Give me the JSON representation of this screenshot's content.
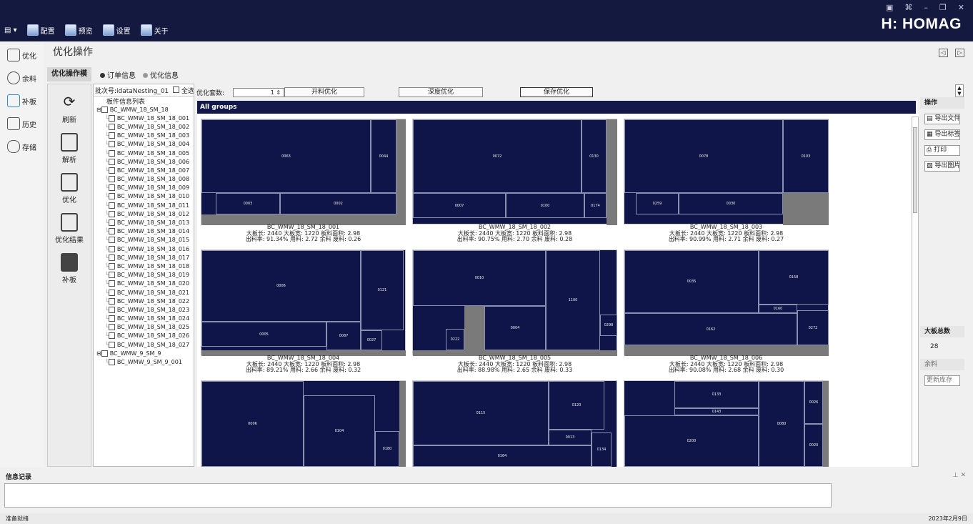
{
  "menu": [
    {
      "label": "配置",
      "icon": "config-icon"
    },
    {
      "label": "预览",
      "icon": "preview-icon"
    },
    {
      "label": "设置",
      "icon": "settings-icon"
    },
    {
      "label": "关于",
      "icon": "about-icon"
    }
  ],
  "brand": "HOMAG",
  "nav": [
    {
      "label": "优化",
      "icon": "optimize-icon"
    },
    {
      "label": "余料",
      "icon": "remnant-icon"
    },
    {
      "label": "补板",
      "icon": "supplement-icon"
    },
    {
      "label": "历史",
      "icon": "history-icon"
    },
    {
      "label": "存储",
      "icon": "storage-icon"
    }
  ],
  "page_title": "优化操作",
  "tool_tab": "优化操作模",
  "sub_tabs": [
    "订单信息",
    "优化信息"
  ],
  "tools": [
    {
      "label": "刷新",
      "icon": "refresh-icon"
    },
    {
      "label": "解析",
      "icon": "parse-icon"
    },
    {
      "label": "优化",
      "icon": "optimize-icon"
    },
    {
      "label": "优化结果",
      "icon": "result-icon"
    },
    {
      "label": "补板",
      "icon": "supplement-icon"
    }
  ],
  "batch": {
    "label": "批次号:idataNesting_01",
    "select_all": "全选"
  },
  "tree": {
    "header": "板件信息列表",
    "root1": "BC_WMW_18_SM_18",
    "items": [
      "BC_WMW_18_SM_18_001",
      "BC_WMW_18_SM_18_002",
      "BC_WMW_18_SM_18_003",
      "BC_WMW_18_SM_18_004",
      "BC_WMW_18_SM_18_005",
      "BC_WMW_18_SM_18_006",
      "BC_WMW_18_SM_18_007",
      "BC_WMW_18_SM_18_008",
      "BC_WMW_18_SM_18_009",
      "BC_WMW_18_SM_18_010",
      "BC_WMW_18_SM_18_011",
      "BC_WMW_18_SM_18_012",
      "BC_WMW_18_SM_18_013",
      "BC_WMW_18_SM_18_014",
      "BC_WMW_18_SM_18_015",
      "BC_WMW_18_SM_18_016",
      "BC_WMW_18_SM_18_017",
      "BC_WMW_18_SM_18_018",
      "BC_WMW_18_SM_18_019",
      "BC_WMW_18_SM_18_020",
      "BC_WMW_18_SM_18_021",
      "BC_WMW_18_SM_18_022",
      "BC_WMW_18_SM_18_023",
      "BC_WMW_18_SM_18_024",
      "BC_WMW_18_SM_18_025",
      "BC_WMW_18_SM_18_026",
      "BC_WMW_18_SM_18_027"
    ],
    "root2": "BC_WMW_9_SM_9",
    "items2": [
      "BC_WMW_9_SM_9_001"
    ]
  },
  "opt": {
    "sets_label": "优化套数:",
    "sets_value": "1",
    "btn_open": "开料优化",
    "btn_deep": "深度优化",
    "btn_save": "保存优化"
  },
  "group_title": "All groups",
  "sheets": [
    {
      "name": "BC_WMW_18_SM_18_001",
      "l1": "大板长: 2440 大板宽: 1220 板料面积: 2.98",
      "l2": "出料率: 91.34% 用料: 2.72 余料 废料: 0.26"
    },
    {
      "name": "BC_WMW_18_SM_18_002",
      "l1": "大板长: 2440 大板宽: 1220 板料面积: 2.98",
      "l2": "出料率: 90.75% 用料: 2.70 余料 废料: 0.28"
    },
    {
      "name": "BC_WMW_18_SM_18_003",
      "l1": "大板长: 2440 大板宽: 1220 板料面积: 2.98",
      "l2": "出料率: 90.99% 用料: 2.71 余料 废料: 0.27"
    },
    {
      "name": "BC_WMW_18_SM_18_004",
      "l1": "大板长: 2440 大板宽: 1220 板料面积: 2.98",
      "l2": "出料率: 89.21% 用料: 2.66 余料 废料: 0.32"
    },
    {
      "name": "BC_WMW_18_SM_18_005",
      "l1": "大板长: 2440 大板宽: 1220 板料面积: 2.98",
      "l2": "出料率: 88.98% 用料: 2.65 余料 废料: 0.33"
    },
    {
      "name": "BC_WMW_18_SM_18_006",
      "l1": "大板长: 2440 大板宽: 1220 板料面积: 2.98",
      "l2": "出料率: 90.08% 用料: 2.68 余料 废料: 0.30"
    }
  ],
  "parts": [
    [
      "0063",
      "0044",
      "0003",
      "0002"
    ],
    [
      "0072",
      "0130",
      "0007",
      "0100",
      "0174"
    ],
    [
      "0078",
      "0103",
      "0259",
      "0030"
    ],
    [
      "0006",
      "0121",
      "0005",
      "0027",
      "0087"
    ],
    [
      "0010",
      "1100",
      "0004",
      "0298",
      "0222"
    ],
    [
      "0035",
      "0158",
      "0162",
      "0272",
      "0160"
    ],
    [
      "0006",
      "0104",
      "0180"
    ],
    [
      "0115",
      "0120",
      "0164",
      "0134",
      "0013"
    ],
    [
      "0133",
      "0143",
      "0026",
      "0200",
      "0080",
      "0020"
    ]
  ],
  "right": {
    "ops_title": "操作",
    "buttons": [
      "导出文件",
      "导出标签",
      "打印",
      "导出图片"
    ],
    "total_title": "大板总数",
    "total_value": "28",
    "remnant": "余料",
    "update": "更新库存"
  },
  "info_title": "信息记录",
  "status_left": "准备就绪",
  "status_right": "2023年2月9日"
}
